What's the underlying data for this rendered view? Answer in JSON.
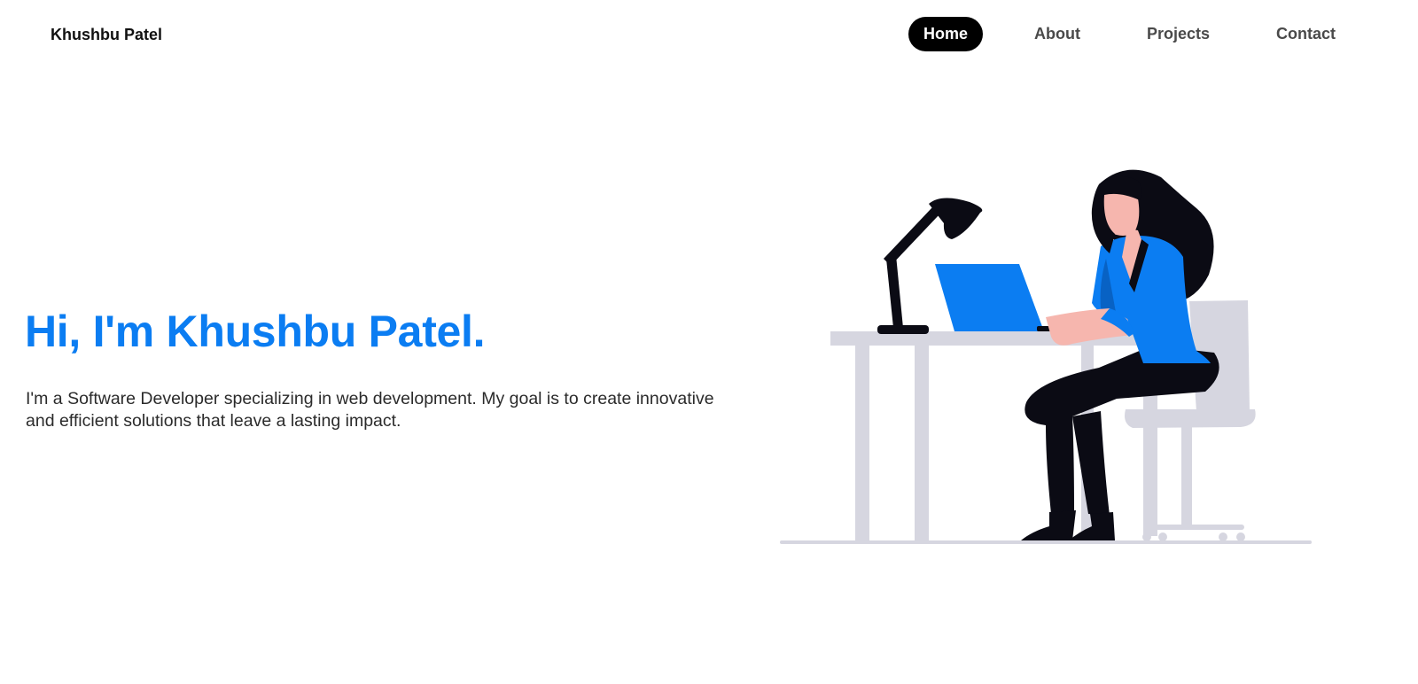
{
  "brand": {
    "name": "Khushbu Patel"
  },
  "nav": {
    "items": [
      {
        "label": "Home",
        "active": true
      },
      {
        "label": "About",
        "active": false
      },
      {
        "label": "Projects",
        "active": false
      },
      {
        "label": "Contact",
        "active": false
      }
    ]
  },
  "hero": {
    "title": "Hi, I'm Khushbu Patel.",
    "description": "I'm a Software Developer specializing in web development. My goal is to create innovative and efficient solutions that leave a lasting impact."
  },
  "illustration": {
    "name": "woman-working-at-desk-illustration"
  },
  "colors": {
    "accent": "#0b7df2",
    "nav_active_bg": "#000000",
    "text": "#2b2b2b",
    "furniture": "#d6d6e0",
    "dark": "#0b0b14",
    "skin": "#f6b6ae"
  }
}
